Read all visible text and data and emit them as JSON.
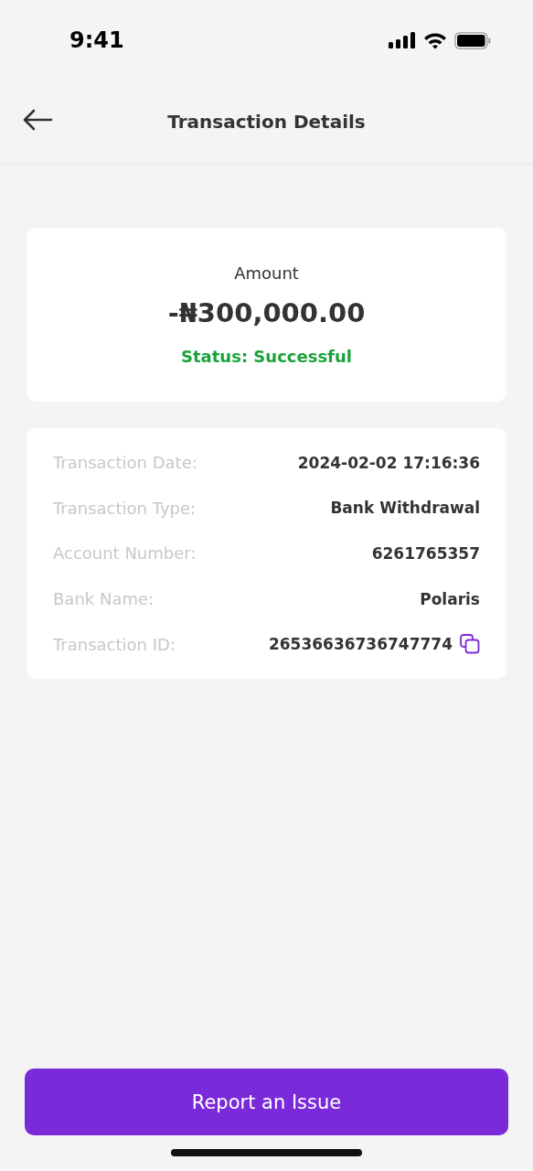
{
  "status_bar": {
    "time": "9:41"
  },
  "header": {
    "title": "Transaction Details"
  },
  "summary": {
    "label": "Amount",
    "amount": "-₦300,000.00",
    "status": "Status: Successful"
  },
  "details": [
    {
      "label": "Transaction Date:",
      "value": "2024-02-02 17:16:36",
      "copyable": false
    },
    {
      "label": "Transaction Type:",
      "value": "Bank Withdrawal",
      "copyable": false
    },
    {
      "label": "Account Number:",
      "value": "6261765357",
      "copyable": false
    },
    {
      "label": "Bank Name:",
      "value": "Polaris",
      "copyable": false
    },
    {
      "label": "Transaction ID:",
      "value": "26536636736747774",
      "copyable": true
    }
  ],
  "button": {
    "label": "Report an Issue"
  }
}
